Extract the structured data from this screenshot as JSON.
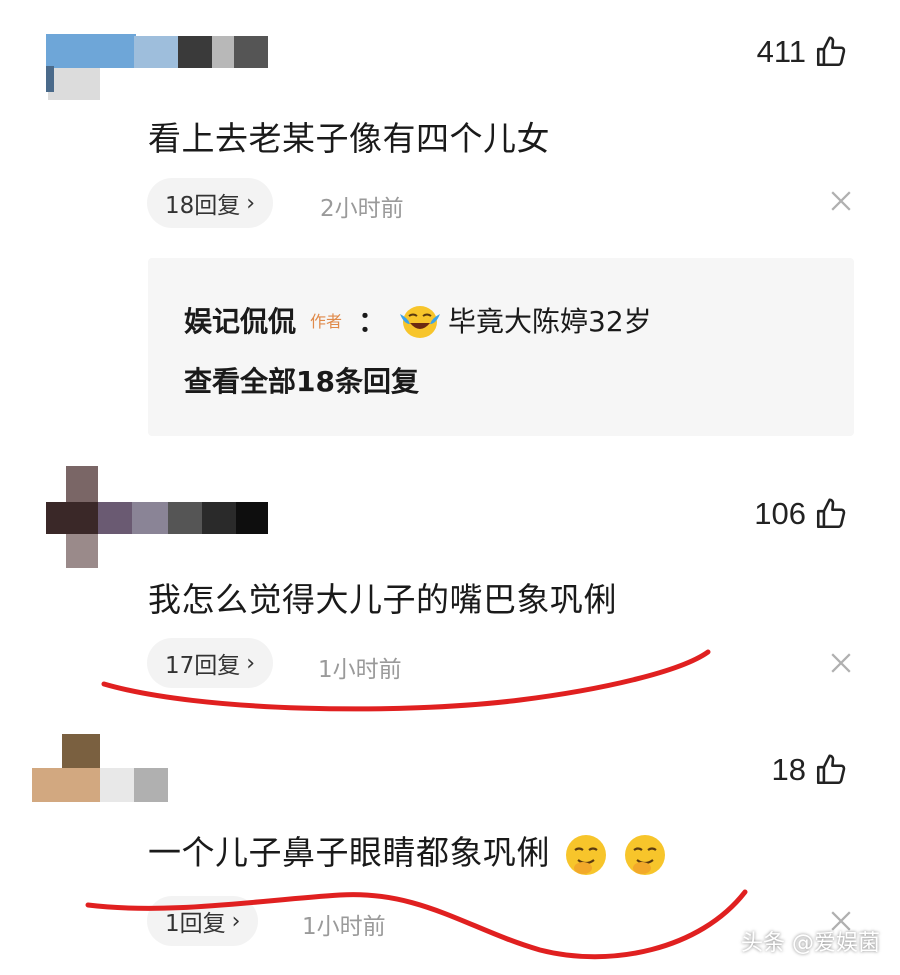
{
  "comments": [
    {
      "likes": "411",
      "text": "看上去老某子像有四个儿女",
      "reply_count_label": "18回复",
      "time": "2小时前",
      "reply_preview": {
        "author": "娱记侃侃",
        "badge": "作者",
        "colon": "：",
        "text": "毕竟大陈婷32岁",
        "view_all": "查看全部18条回复"
      }
    },
    {
      "likes": "106",
      "text": "我怎么觉得大儿子的嘴巴象巩俐",
      "reply_count_label": "17回复",
      "time": "1小时前"
    },
    {
      "likes": "18",
      "text": "一个儿子鼻子眼睛都象巩俐",
      "reply_count_label": "1回复",
      "time": "1小时前"
    }
  ],
  "watermark": "头条 @爱娱菌",
  "icons": {
    "like": "thumbs-up-icon",
    "close": "close-icon",
    "chevron": "chevron-right-icon",
    "cry_emoji": "crying-laughing-emoji-icon",
    "smirk_emoji": "smirk-emoji-icon"
  },
  "colors": {
    "annotation_red": "#e02020",
    "author_badge": "#e08a4a"
  }
}
